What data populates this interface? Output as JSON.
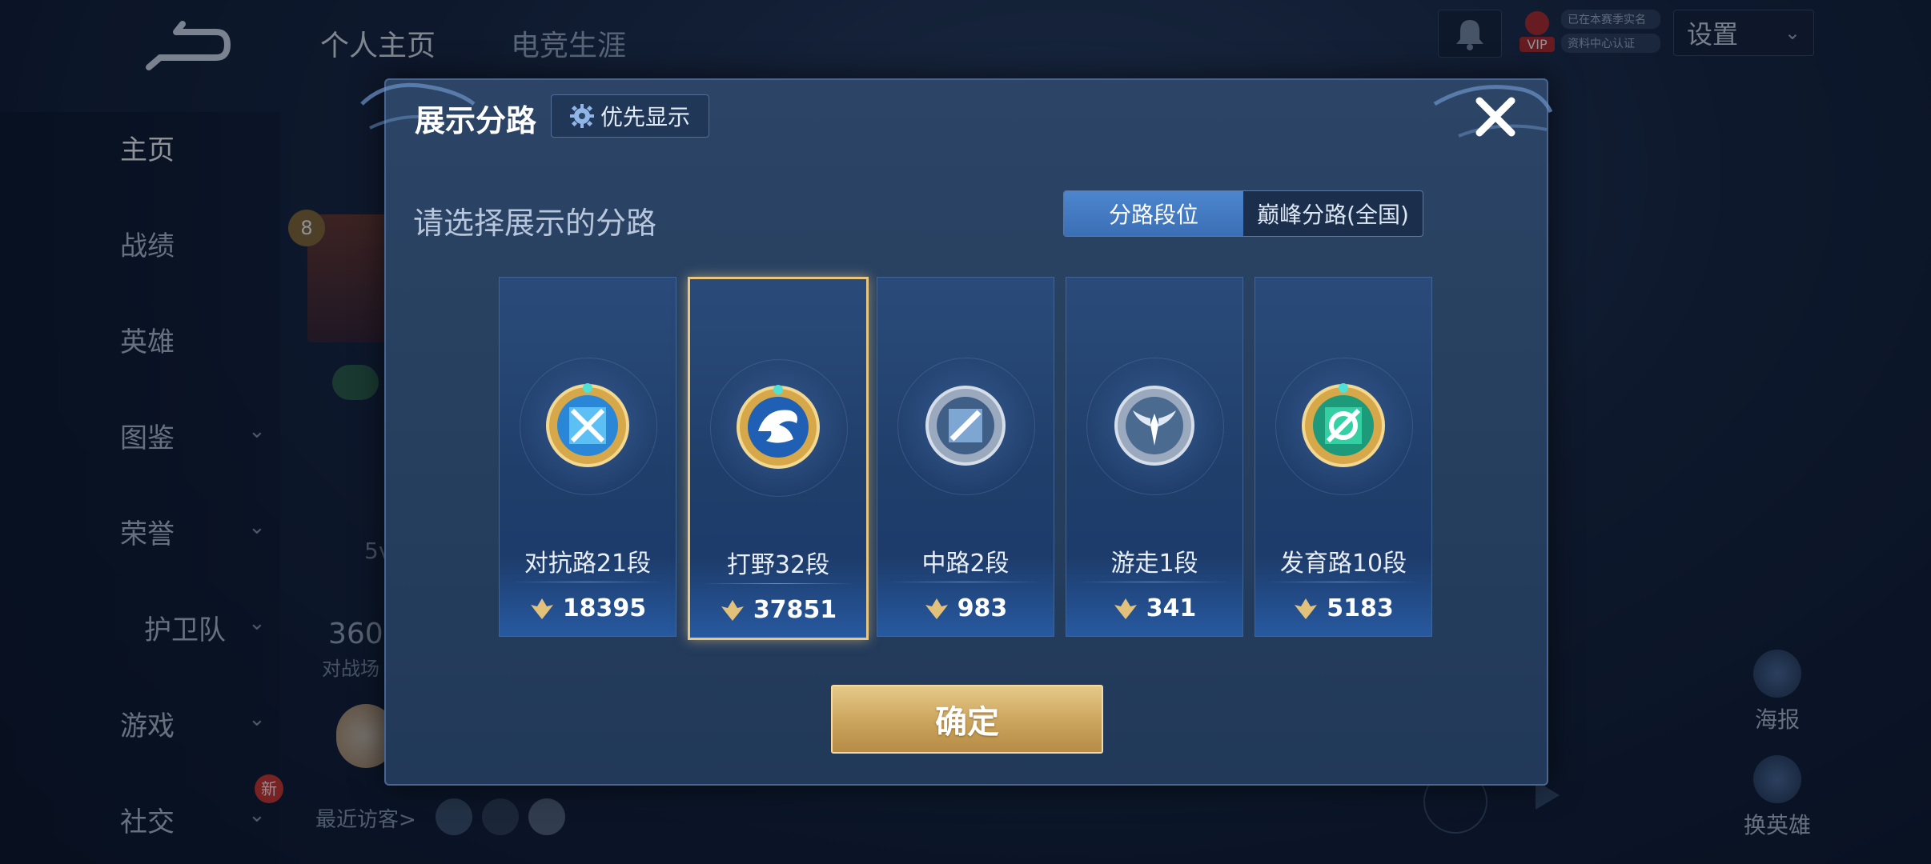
{
  "background": {
    "top_tabs": [
      "个人主页",
      "电竞生涯"
    ],
    "sidebar_items": [
      {
        "label": "主页",
        "chevron": false
      },
      {
        "label": "战绩",
        "chevron": false
      },
      {
        "label": "英雄",
        "chevron": false
      },
      {
        "label": "图鉴",
        "chevron": true
      },
      {
        "label": "荣誉",
        "chevron": true
      },
      {
        "label": "护卫队",
        "chevron": true
      },
      {
        "label": "游戏",
        "chevron": true
      },
      {
        "label": "社交",
        "chevron": true
      }
    ],
    "new_badge": "新",
    "level_badge": "8",
    "stat_value": "360",
    "stat_label": "对战场",
    "partial_text": "5v",
    "recent_visitors": "最近访客>",
    "vip_label": "VIP",
    "vip_line1": "已在本赛季实名",
    "vip_line2": "资料中心认证",
    "settings": "设置",
    "right_items": [
      "海报",
      "换英雄"
    ]
  },
  "modal": {
    "title": "展示分路",
    "priority_button": "优先显示",
    "subtitle": "请选择展示的分路",
    "toggle": {
      "options": [
        "分路段位",
        "巅峰分路(全国)"
      ],
      "active_index": 0
    },
    "confirm": "确定",
    "cards": [
      {
        "label": "对抗路21段",
        "score": "18395",
        "emblem": "crossed-swords-emblem-icon",
        "accent": "#3aa0e8",
        "selected": false
      },
      {
        "label": "打野32段",
        "score": "37851",
        "emblem": "dragon-emblem-icon",
        "accent": "#4a8fe0",
        "selected": true
      },
      {
        "label": "中路2段",
        "score": "983",
        "emblem": "staff-emblem-icon",
        "accent": "#6f8fb8",
        "selected": false
      },
      {
        "label": "游走1段",
        "score": "341",
        "emblem": "wings-emblem-icon",
        "accent": "#8aa6c8",
        "selected": false
      },
      {
        "label": "发育路10段",
        "score": "5183",
        "emblem": "target-emblem-icon",
        "accent": "#2fc39a",
        "selected": false
      }
    ]
  },
  "colors": {
    "gold": "#e8c682",
    "accent_blue": "#4d86cf"
  }
}
